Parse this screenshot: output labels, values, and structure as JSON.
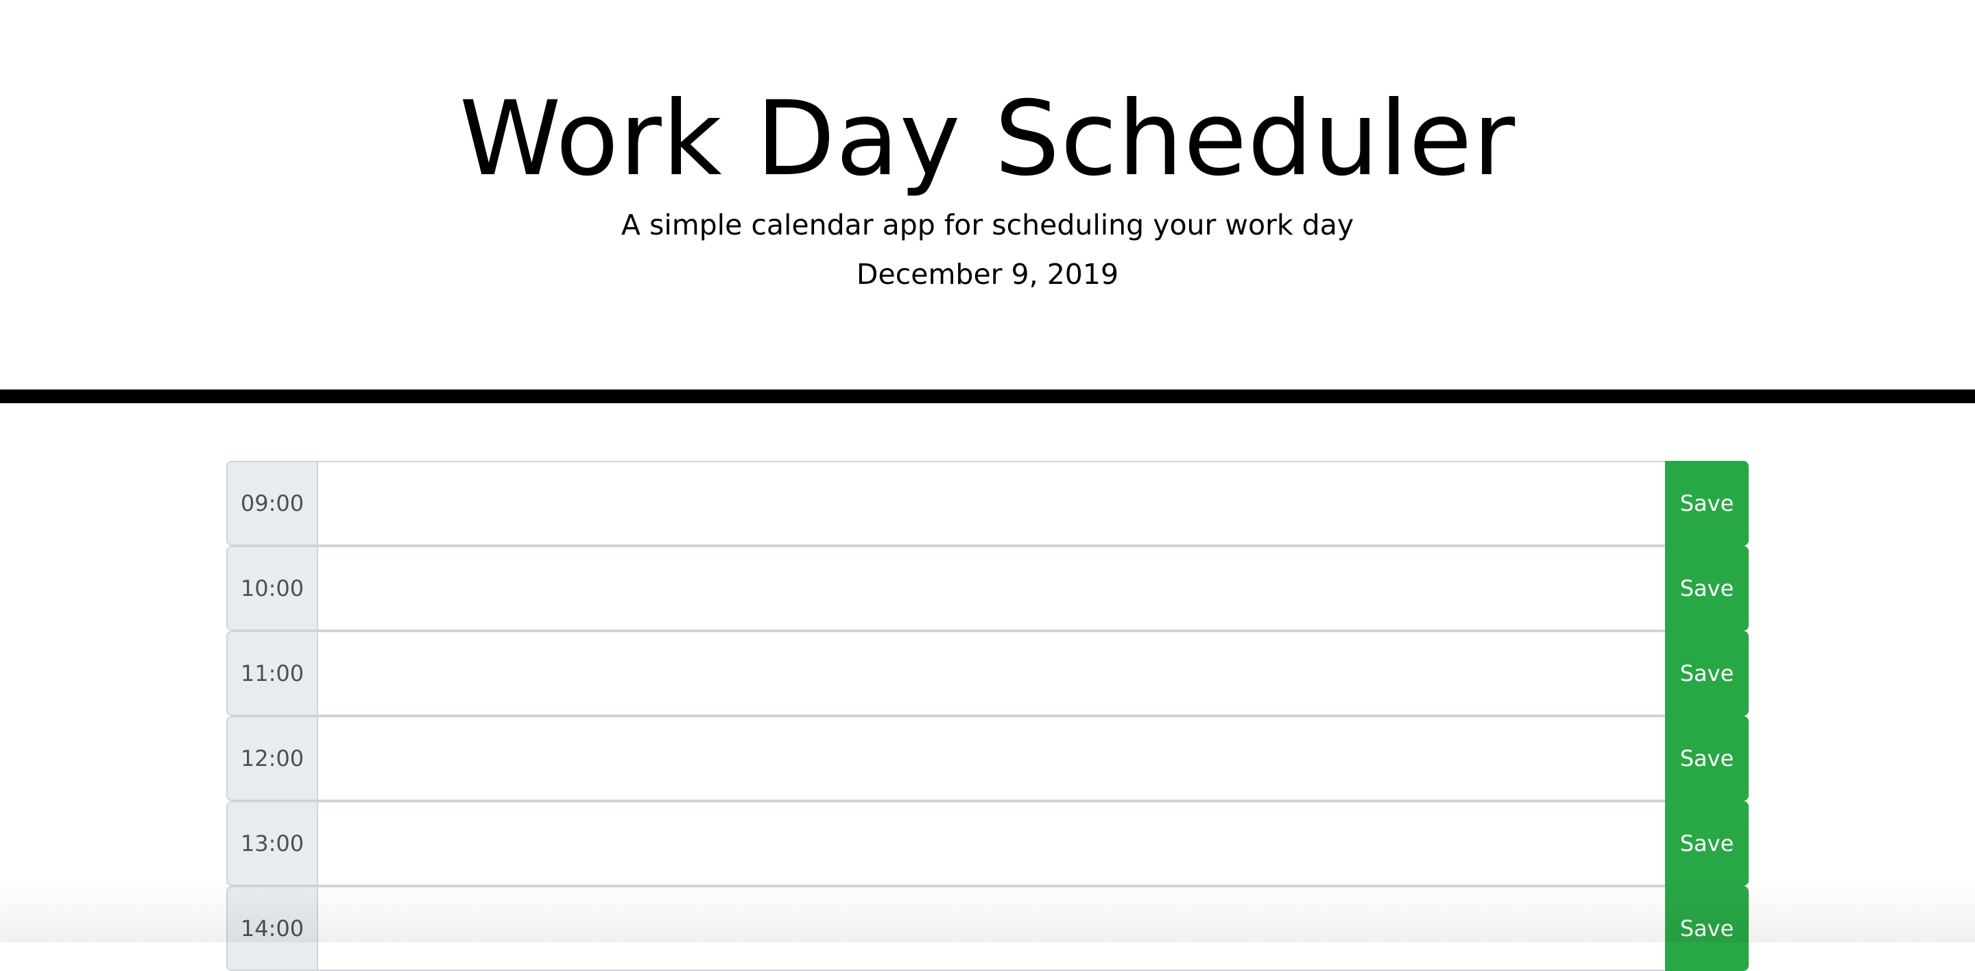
{
  "header": {
    "title": "Work Day Scheduler",
    "subtitle": "A simple calendar app for scheduling your work day",
    "date": "December 9, 2019"
  },
  "schedule": {
    "rows": [
      {
        "hour": "09:00",
        "text": "",
        "save_label": "Save"
      },
      {
        "hour": "10:00",
        "text": "",
        "save_label": "Save"
      },
      {
        "hour": "11:00",
        "text": "",
        "save_label": "Save"
      },
      {
        "hour": "12:00",
        "text": "",
        "save_label": "Save"
      },
      {
        "hour": "13:00",
        "text": "",
        "save_label": "Save"
      },
      {
        "hour": "14:00",
        "text": "",
        "save_label": "Save"
      }
    ]
  },
  "colors": {
    "save_button": "#28a745",
    "hour_background": "#e9ecef",
    "divider": "#000000"
  }
}
